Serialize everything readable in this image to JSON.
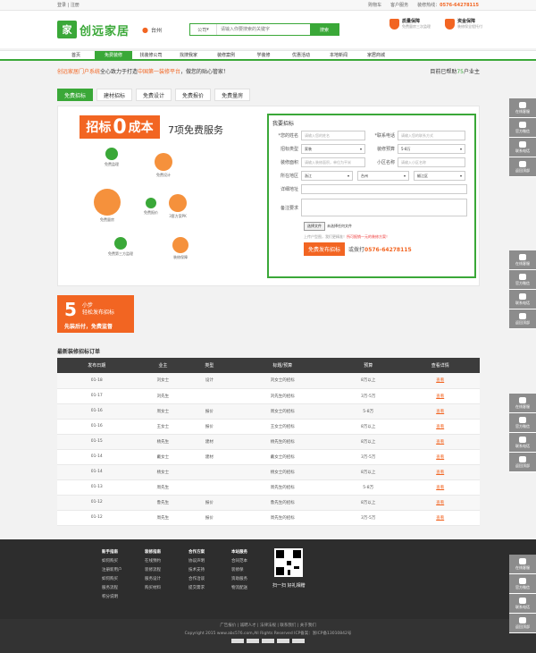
{
  "topbar": {
    "login": "登录",
    "register": "注册",
    "cart": "购物车",
    "service": "客户服务",
    "hotline_label": "装修热线：",
    "hotline": "0576-64278115"
  },
  "logo": {
    "mark": "家",
    "text": "创远家居"
  },
  "city": "台州",
  "search": {
    "scope": "公司",
    "placeholder": "请输入你要搜索的关键字",
    "button": "搜索"
  },
  "guarantees": [
    {
      "title": "质量保障",
      "sub": "免费量房三次监理"
    },
    {
      "title": "资金保障",
      "sub": "装修保全程托付"
    }
  ],
  "nav": [
    "首页",
    "免费装修",
    "找装修公司",
    "找搜我家",
    "装修案例",
    "学装修",
    "优惠活动",
    "本地新闻",
    "家居商城"
  ],
  "slogan": {
    "brand": "创远家居门户系统",
    "mid": "全心致力于打造",
    "em": "中国第一装修平台",
    "tail": "，做您的贴心管家！",
    "right_prefix": "目前已帮助",
    "right_count": "75",
    "right_suffix": "户业主"
  },
  "tabs": [
    "免费招标",
    "建材招标",
    "免费设计",
    "免费报价",
    "免费量房"
  ],
  "promo": {
    "badge_pre": "招标",
    "badge_zero": "0",
    "badge_post": "成本",
    "seven": "7项免费服务"
  },
  "services": [
    "免费监理",
    "免费设计",
    "免费量房",
    "免费报价",
    "3套方案PK",
    "免费第三方监理",
    "装修保障"
  ],
  "form": {
    "title": "我要招标",
    "name_label": "*您的姓名",
    "name_ph": "请输入您的姓名",
    "phone_label": "*联系电话",
    "phone_ph": "请输入您的联系方式",
    "type_label": "招标类型",
    "type_val": "家装",
    "budget_label": "装修预算",
    "budget_val": "5-8万",
    "area_label": "装修面积",
    "area_ph": "请输入装修面积，单位为平米",
    "community_label": "小区名称",
    "community_ph": "请输入小区名称",
    "region_label": "所在地区",
    "province": "浙江",
    "city": "台州",
    "district": "椒江区",
    "address_label": "详细地址",
    "note_label": "备注要求",
    "upload_btn": "选择文件",
    "upload_tip": "未选择任何文件",
    "tip_pre": "上传户型图，我们更精准！",
    "tip_red": "所可报销一元的装修方案！",
    "submit": "免费发布招标",
    "call_pre": "或拨打",
    "call_num": "0576-64278115"
  },
  "steps": {
    "num": "5",
    "s1": "小步",
    "s2": "轻松发布招标",
    "s3": "先装后付，免费监督"
  },
  "orders": {
    "title": "最新装修招标订单",
    "headers": [
      "发布日期",
      "业主",
      "类型",
      "标题/预算",
      "预算",
      "查看详情"
    ],
    "rows": [
      [
        "01-18",
        "刘女士",
        "设计",
        "刘女士的招标",
        "8万以上",
        "查看"
      ],
      [
        "01-17",
        "刘先生",
        "",
        "刘先生的招标",
        "3万-5万",
        "查看"
      ],
      [
        "01-16",
        "周女士",
        "报价",
        "周女士的招标",
        "5-8万",
        "查看"
      ],
      [
        "01-16",
        "王女士",
        "报价",
        "王女士的招标",
        "8万以上",
        "查看"
      ],
      [
        "01-15",
        "杨先生",
        "建材",
        "杨先生的招标",
        "8万以上",
        "查看"
      ],
      [
        "01-14",
        "戴女士",
        "建材",
        "戴女士的招标",
        "3万-5万",
        "查看"
      ],
      [
        "01-14",
        "杨女士",
        "",
        "杨女士的招标",
        "8万以上",
        "查看"
      ],
      [
        "01-13",
        "周先生",
        "",
        "周先生的招标",
        "5-8万",
        "查看"
      ],
      [
        "01-12",
        "鲁先生",
        "报价",
        "鲁先生的招标",
        "8万以上",
        "查看"
      ],
      [
        "01-12",
        "周先生",
        "报价",
        "周先生的招标",
        "3万-5万",
        "查看"
      ]
    ]
  },
  "footer": {
    "cols": [
      {
        "h": "新手指南",
        "items": [
          "如何购买",
          "注册新用户",
          "如何购买",
          "服务流程",
          "积分说明"
        ]
      },
      {
        "h": "装修指南",
        "items": [
          "在线预约",
          "装修流程",
          "服务设计",
          "购买材料"
        ]
      },
      {
        "h": "合作方案",
        "items": [
          "协议声明",
          "技术支持",
          "合作洽谈",
          "提交需求"
        ]
      },
      {
        "h": "本站服务",
        "items": [
          "合同范本",
          "装修保",
          "资助服务",
          "物流配送"
        ]
      }
    ],
    "qr_text": "扫一扫 好礼相赠",
    "links": "广告报价 | 诚聘人才 | 法律法规 | 联系我们 | 关于我们",
    "copyright": "Copyright 2015 www.abc576.com,All Rights Reserved ICP备案：浙ICP备13010842号"
  },
  "side": [
    "在线客服",
    "官方微信",
    "联系电话",
    "返回顶部"
  ]
}
